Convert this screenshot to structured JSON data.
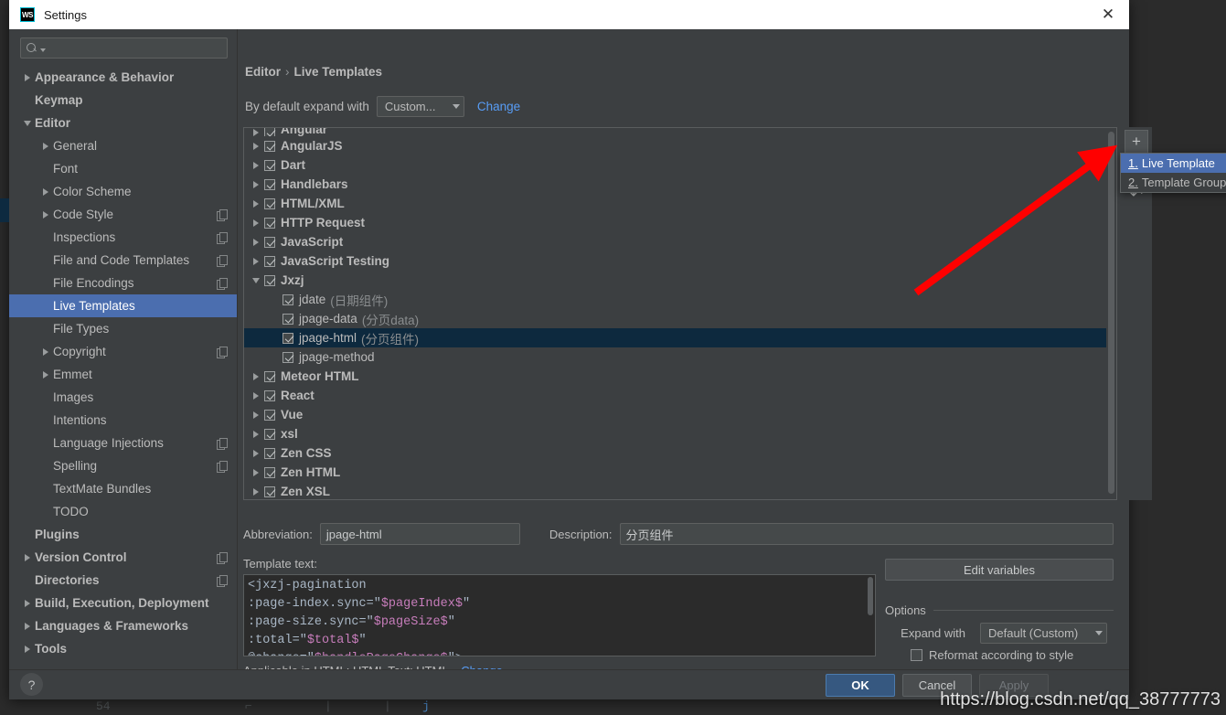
{
  "window": {
    "title": "Settings",
    "logo_text": "WS",
    "close_label": "✕"
  },
  "sidebar": {
    "search_placeholder": "",
    "items": [
      {
        "label": "Appearance & Behavior",
        "indent": 0,
        "arrow": "right",
        "bold": true,
        "copy": false,
        "selected": false
      },
      {
        "label": "Keymap",
        "indent": 0,
        "arrow": "none",
        "bold": true,
        "copy": false,
        "selected": false
      },
      {
        "label": "Editor",
        "indent": 0,
        "arrow": "down",
        "bold": true,
        "copy": false,
        "selected": false
      },
      {
        "label": "General",
        "indent": 1,
        "arrow": "right",
        "bold": false,
        "copy": false,
        "selected": false
      },
      {
        "label": "Font",
        "indent": 1,
        "arrow": "none",
        "bold": false,
        "copy": false,
        "selected": false
      },
      {
        "label": "Color Scheme",
        "indent": 1,
        "arrow": "right",
        "bold": false,
        "copy": false,
        "selected": false
      },
      {
        "label": "Code Style",
        "indent": 1,
        "arrow": "right",
        "bold": false,
        "copy": true,
        "selected": false
      },
      {
        "label": "Inspections",
        "indent": 1,
        "arrow": "none",
        "bold": false,
        "copy": true,
        "selected": false
      },
      {
        "label": "File and Code Templates",
        "indent": 1,
        "arrow": "none",
        "bold": false,
        "copy": true,
        "selected": false
      },
      {
        "label": "File Encodings",
        "indent": 1,
        "arrow": "none",
        "bold": false,
        "copy": true,
        "selected": false
      },
      {
        "label": "Live Templates",
        "indent": 1,
        "arrow": "none",
        "bold": false,
        "copy": false,
        "selected": true
      },
      {
        "label": "File Types",
        "indent": 1,
        "arrow": "none",
        "bold": false,
        "copy": false,
        "selected": false
      },
      {
        "label": "Copyright",
        "indent": 1,
        "arrow": "right",
        "bold": false,
        "copy": true,
        "selected": false
      },
      {
        "label": "Emmet",
        "indent": 1,
        "arrow": "right",
        "bold": false,
        "copy": false,
        "selected": false
      },
      {
        "label": "Images",
        "indent": 1,
        "arrow": "none",
        "bold": false,
        "copy": false,
        "selected": false
      },
      {
        "label": "Intentions",
        "indent": 1,
        "arrow": "none",
        "bold": false,
        "copy": false,
        "selected": false
      },
      {
        "label": "Language Injections",
        "indent": 1,
        "arrow": "none",
        "bold": false,
        "copy": true,
        "selected": false
      },
      {
        "label": "Spelling",
        "indent": 1,
        "arrow": "none",
        "bold": false,
        "copy": true,
        "selected": false
      },
      {
        "label": "TextMate Bundles",
        "indent": 1,
        "arrow": "none",
        "bold": false,
        "copy": false,
        "selected": false
      },
      {
        "label": "TODO",
        "indent": 1,
        "arrow": "none",
        "bold": false,
        "copy": false,
        "selected": false
      },
      {
        "label": "Plugins",
        "indent": 0,
        "arrow": "none",
        "bold": true,
        "copy": false,
        "selected": false
      },
      {
        "label": "Version Control",
        "indent": 0,
        "arrow": "right",
        "bold": true,
        "copy": true,
        "selected": false
      },
      {
        "label": "Directories",
        "indent": 0,
        "arrow": "none",
        "bold": true,
        "copy": true,
        "selected": false
      },
      {
        "label": "Build, Execution, Deployment",
        "indent": 0,
        "arrow": "right",
        "bold": true,
        "copy": false,
        "selected": false
      },
      {
        "label": "Languages & Frameworks",
        "indent": 0,
        "arrow": "right",
        "bold": true,
        "copy": false,
        "selected": false
      },
      {
        "label": "Tools",
        "indent": 0,
        "arrow": "right",
        "bold": true,
        "copy": false,
        "selected": false
      }
    ]
  },
  "content": {
    "breadcrumb": {
      "root": "Editor",
      "separator": "›",
      "current": "Live Templates"
    },
    "expand_row": {
      "label": "By default expand with",
      "combo_value": "Custom...",
      "change_link": "Change"
    },
    "templates": [
      {
        "label": "Angular",
        "desc": "",
        "type": "group",
        "arrow": "right",
        "checked": true,
        "selected": false,
        "clipped": true
      },
      {
        "label": "AngularJS",
        "desc": "",
        "type": "group",
        "arrow": "right",
        "checked": true,
        "selected": false
      },
      {
        "label": "Dart",
        "desc": "",
        "type": "group",
        "arrow": "right",
        "checked": true,
        "selected": false
      },
      {
        "label": "Handlebars",
        "desc": "",
        "type": "group",
        "arrow": "right",
        "checked": true,
        "selected": false
      },
      {
        "label": "HTML/XML",
        "desc": "",
        "type": "group",
        "arrow": "right",
        "checked": true,
        "selected": false
      },
      {
        "label": "HTTP Request",
        "desc": "",
        "type": "group",
        "arrow": "right",
        "checked": true,
        "selected": false
      },
      {
        "label": "JavaScript",
        "desc": "",
        "type": "group",
        "arrow": "right",
        "checked": true,
        "selected": false
      },
      {
        "label": "JavaScript Testing",
        "desc": "",
        "type": "group",
        "arrow": "right",
        "checked": true,
        "selected": false
      },
      {
        "label": "Jxzj",
        "desc": "",
        "type": "group",
        "arrow": "down",
        "checked": true,
        "selected": false
      },
      {
        "label": "jdate",
        "desc": "(日期组件)",
        "type": "item",
        "arrow": "none",
        "checked": true,
        "selected": false
      },
      {
        "label": "jpage-data",
        "desc": "(分页data)",
        "type": "item",
        "arrow": "none",
        "checked": true,
        "selected": false
      },
      {
        "label": "jpage-html",
        "desc": "(分页组件)",
        "type": "item",
        "arrow": "none",
        "checked": true,
        "selected": true
      },
      {
        "label": "jpage-method",
        "desc": "",
        "type": "item",
        "arrow": "none",
        "checked": true,
        "selected": false
      },
      {
        "label": "Meteor HTML",
        "desc": "",
        "type": "group",
        "arrow": "right",
        "checked": true,
        "selected": false
      },
      {
        "label": "React",
        "desc": "",
        "type": "group",
        "arrow": "right",
        "checked": true,
        "selected": false
      },
      {
        "label": "Vue",
        "desc": "",
        "type": "group",
        "arrow": "right",
        "checked": true,
        "selected": false
      },
      {
        "label": "xsl",
        "desc": "",
        "type": "group",
        "arrow": "right",
        "checked": true,
        "selected": false
      },
      {
        "label": "Zen CSS",
        "desc": "",
        "type": "group",
        "arrow": "right",
        "checked": true,
        "selected": false
      },
      {
        "label": "Zen HTML",
        "desc": "",
        "type": "group",
        "arrow": "right",
        "checked": true,
        "selected": false
      },
      {
        "label": "Zen XSL",
        "desc": "",
        "type": "group",
        "arrow": "right",
        "checked": true,
        "selected": false
      }
    ],
    "toolbar": {
      "add_label": "+",
      "remove_label": "−",
      "revert_label": "↶"
    },
    "popup_menu": {
      "items": [
        {
          "number": "1.",
          "label": "Live Template",
          "highlighted": true
        },
        {
          "number": "2.",
          "label": "Template Group...",
          "highlighted": false
        }
      ]
    },
    "form": {
      "abbreviation_label": "Abbreviation:",
      "abbreviation_value": "jpage-html",
      "description_label": "Description:",
      "description_value": "分页组件",
      "template_text_label": "Template text:",
      "template_lines": [
        {
          "parts": [
            {
              "t": "<jxzj-pagination",
              "c": "s"
            }
          ]
        },
        {
          "parts": [
            {
              "t": "  :page-index.sync=\"",
              "c": "s"
            },
            {
              "t": "$pageIndex$",
              "c": "v"
            },
            {
              "t": "\"",
              "c": "s"
            }
          ]
        },
        {
          "parts": [
            {
              "t": "  :page-size.sync=\"",
              "c": "s"
            },
            {
              "t": "$pageSize$",
              "c": "v"
            },
            {
              "t": "\"",
              "c": "s"
            }
          ]
        },
        {
          "parts": [
            {
              "t": "  :total=\"",
              "c": "s"
            },
            {
              "t": "$total$",
              "c": "v"
            },
            {
              "t": "\"",
              "c": "s"
            }
          ]
        },
        {
          "parts": [
            {
              "t": "  @change=\"",
              "c": "s"
            },
            {
              "t": "$handlePageChange$",
              "c": "v"
            },
            {
              "t": "\">",
              "c": "s"
            }
          ]
        }
      ],
      "applicable_text": "Applicable in HTML: HTML Text; HTML.",
      "applicable_change_link": "Change"
    },
    "options": {
      "edit_variables_label": "Edit variables",
      "edit_variables_mnemonic": "E",
      "section_label": "Options",
      "expand_with_label": "Expand with",
      "expand_with_value": "Default (Custom)",
      "reformat_label": "Reformat according to style",
      "reformat_checked": false
    }
  },
  "footer": {
    "help_label": "?",
    "ok_label": "OK",
    "cancel_label": "Cancel",
    "apply_label": "Apply"
  },
  "annotation": {
    "watermark": "https://blog.csdn.net/qq_38777773",
    "arrow_color": "#ff0000"
  },
  "colors": {
    "window_bg": "#3c3f41",
    "selection_blue": "#4b6eaf",
    "list_selection": "#0d293e",
    "link_blue": "#589df6",
    "ok_button": "#365880"
  }
}
